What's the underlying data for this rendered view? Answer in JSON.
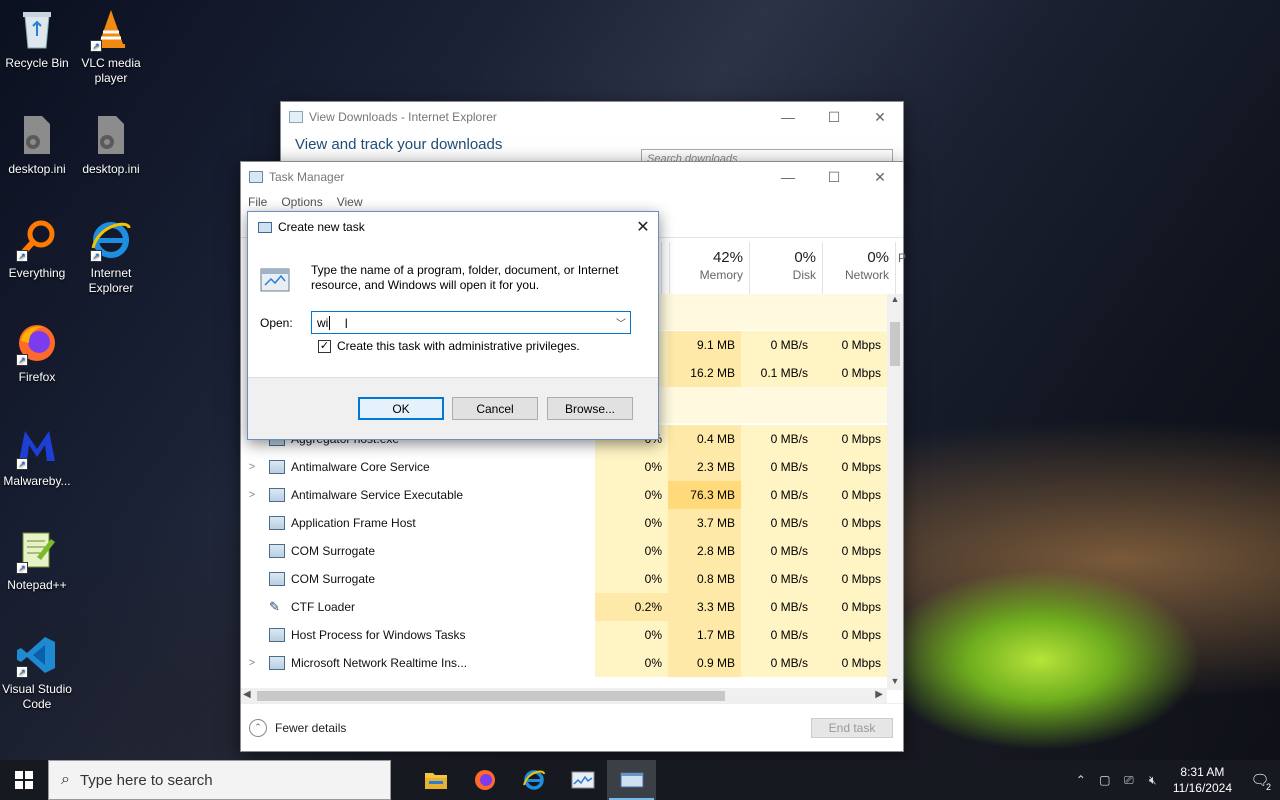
{
  "desktop": {
    "icons": [
      {
        "label": "Recycle Bin"
      },
      {
        "label": "VLC media player"
      },
      {
        "label": "desktop.ini"
      },
      {
        "label": "desktop.ini"
      },
      {
        "label": "Everything"
      },
      {
        "label": "Internet Explorer"
      },
      {
        "label": "Firefox"
      },
      {
        "label": "Malwareby..."
      },
      {
        "label": "Notepad++"
      },
      {
        "label": "Visual Studio Code"
      }
    ]
  },
  "ie_window": {
    "title": "View Downloads - Internet Explorer",
    "heading": "View and track your downloads",
    "search_placeholder": "Search downloads"
  },
  "task_manager": {
    "title": "Task Manager",
    "menu": [
      "File",
      "Options",
      "View"
    ],
    "columns": [
      {
        "pct": "42%",
        "label": "Memory"
      },
      {
        "pct": "0%",
        "label": "Disk"
      },
      {
        "pct": "0%",
        "label": "Network"
      },
      {
        "pct": "",
        "label": "P"
      }
    ],
    "top_rows": [
      {
        "mem": "9.1 MB",
        "disk": "0 MB/s",
        "net": "0 Mbps"
      },
      {
        "mem": "16.2 MB",
        "disk": "0.1 MB/s",
        "net": "0 Mbps"
      }
    ],
    "rows": [
      {
        "name": "Aggregator host.exe",
        "expand": "",
        "cpu": "0%",
        "mem": "0.4 MB",
        "disk": "0 MB/s",
        "net": "0 Mbps"
      },
      {
        "name": "Antimalware Core Service",
        "expand": ">",
        "cpu": "0%",
        "mem": "2.3 MB",
        "disk": "0 MB/s",
        "net": "0 Mbps"
      },
      {
        "name": "Antimalware Service Executable",
        "expand": ">",
        "cpu": "0%",
        "mem": "76.3 MB",
        "disk": "0 MB/s",
        "net": "0 Mbps"
      },
      {
        "name": "Application Frame Host",
        "expand": "",
        "cpu": "0%",
        "mem": "3.7 MB",
        "disk": "0 MB/s",
        "net": "0 Mbps"
      },
      {
        "name": "COM Surrogate",
        "expand": "",
        "cpu": "0%",
        "mem": "2.8 MB",
        "disk": "0 MB/s",
        "net": "0 Mbps"
      },
      {
        "name": "COM Surrogate",
        "expand": "",
        "cpu": "0%",
        "mem": "0.8 MB",
        "disk": "0 MB/s",
        "net": "0 Mbps"
      },
      {
        "name": "CTF Loader",
        "expand": "",
        "cpu": "0.2%",
        "mem": "3.3 MB",
        "disk": "0 MB/s",
        "net": "0 Mbps"
      },
      {
        "name": "Host Process for Windows Tasks",
        "expand": "",
        "cpu": "0%",
        "mem": "1.7 MB",
        "disk": "0 MB/s",
        "net": "0 Mbps"
      },
      {
        "name": "Microsoft Network Realtime Ins...",
        "expand": ">",
        "cpu": "0%",
        "mem": "0.9 MB",
        "disk": "0 MB/s",
        "net": "0 Mbps"
      }
    ],
    "fewer_details": "Fewer details",
    "end_task": "End task"
  },
  "dialog": {
    "title": "Create new task",
    "description": "Type the name of a program, folder, document, or Internet resource, and Windows will open it for you.",
    "open_label": "Open:",
    "input_value": "wi",
    "checkbox_label": "Create this task with administrative privileges.",
    "checkbox_checked": true,
    "ok": "OK",
    "cancel": "Cancel",
    "browse": "Browse..."
  },
  "taskbar": {
    "search_placeholder": "Type here to search",
    "time": "8:31 AM",
    "date": "11/16/2024",
    "notification_count": "2"
  }
}
